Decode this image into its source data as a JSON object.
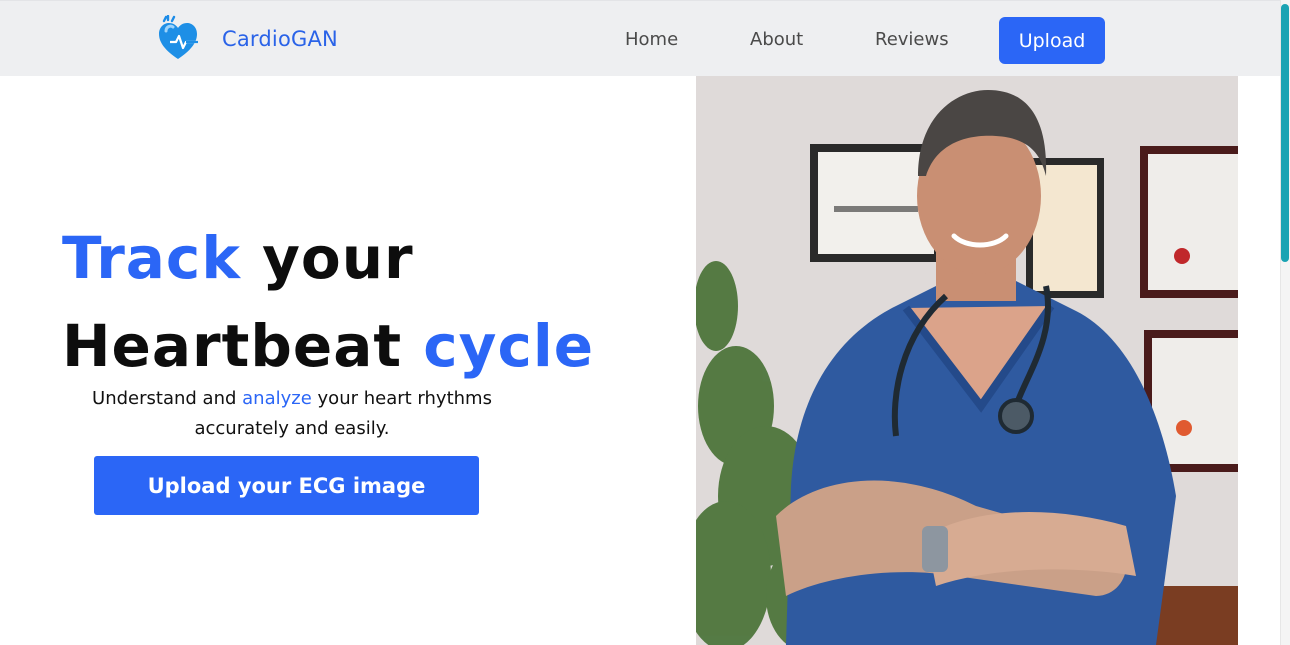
{
  "brand": {
    "name": "CardioGAN",
    "logo_icon": "heart-pulse-icon"
  },
  "nav": {
    "home": "Home",
    "about": "About",
    "reviews": "Reviews",
    "upload": "Upload"
  },
  "hero": {
    "title_line1_accent": "Track",
    "title_line1_rest": "your",
    "title_line2_start": "Heartbeat",
    "title_line2_accent": "cycle",
    "subtitle_start": "Understand and",
    "subtitle_accent": "analyze",
    "subtitle_end": "your heart rhythms accurately and easily.",
    "cta_label": "Upload your ECG image"
  },
  "photo": {
    "subject": "doctor-portrait"
  },
  "colors": {
    "accent": "#2b66f6",
    "nav_bg": "#eeeff1",
    "scrollbar": "#1aa3b3"
  }
}
